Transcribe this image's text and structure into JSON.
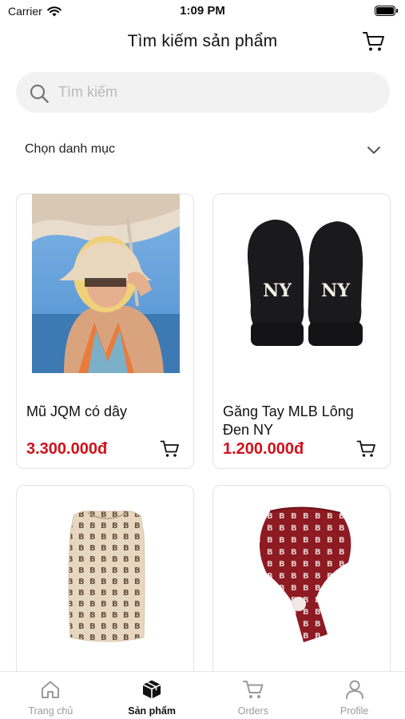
{
  "status_bar": {
    "carrier": "Carrier",
    "time": "1:09 PM"
  },
  "header": {
    "title": "Tìm kiếm sản phẩm",
    "cart_icon": "cart-icon"
  },
  "search": {
    "placeholder": "Tìm kiếm",
    "value": ""
  },
  "category": {
    "label": "Chọn danh mục",
    "icon": "chevron-down-icon"
  },
  "products": [
    {
      "name": "Mũ JQM có dây",
      "price": "3.300.000đ"
    },
    {
      "name": "Găng Tay MLB Lông Đen NY",
      "price": "1.200.000đ"
    },
    {
      "name": "",
      "price": ""
    },
    {
      "name": "",
      "price": ""
    }
  ],
  "tabs": [
    {
      "label": "Trang chủ",
      "icon": "home-icon",
      "active": false
    },
    {
      "label": "Sản phẩm",
      "icon": "box-icon",
      "active": true
    },
    {
      "label": "Orders",
      "icon": "cart-icon",
      "active": false
    },
    {
      "label": "Profile",
      "icon": "person-icon",
      "active": false
    }
  ],
  "colors": {
    "price": "#d0121b",
    "search_bg": "#f2f2f2",
    "tab_inactive": "#9a9a9a"
  }
}
